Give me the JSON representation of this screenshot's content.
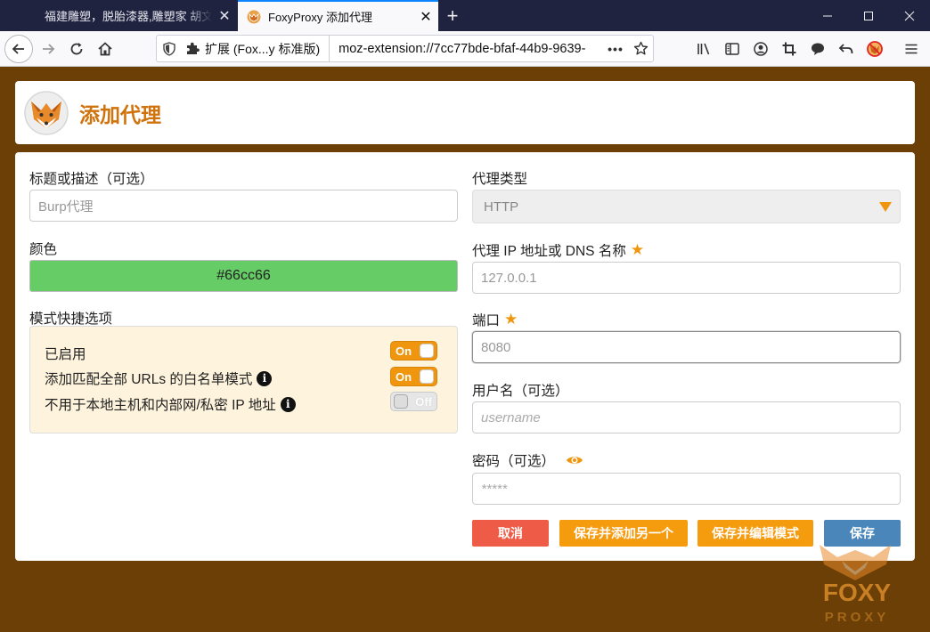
{
  "browser": {
    "tabs": [
      {
        "label": "福建雕塑，脱胎漆器,雕塑家 胡文平"
      },
      {
        "label": "FoxyProxy 添加代理"
      }
    ],
    "url_extension_label": "扩展 (Fox...y 标准版)",
    "url": "moz-extension://7cc77bde-bfaf-44b9-9639-",
    "url_more": "•••"
  },
  "page": {
    "title": "添加代理",
    "left": {
      "title_label": "标题或描述（可选）",
      "title_placeholder": "Burp代理",
      "color_label": "颜色",
      "color_value": "#66cc66",
      "pattern_label": "模式快捷选项",
      "options": [
        {
          "label": "已启用",
          "state": "On",
          "info": false
        },
        {
          "label": "添加匹配全部 URLs 的白名单模式",
          "state": "On",
          "info": true
        },
        {
          "label": "不用于本地主机和内部网/私密 IP 地址",
          "state": "Off",
          "info": true
        }
      ]
    },
    "right": {
      "type_label": "代理类型",
      "type_value": "HTTP",
      "host_label": "代理 IP 地址或 DNS 名称",
      "host_placeholder": "127.0.0.1",
      "port_label": "端口",
      "port_placeholder": "8080",
      "user_label": "用户名（可选）",
      "user_placeholder": "username",
      "pass_label": "密码（可选）",
      "pass_placeholder": "*****"
    },
    "buttons": {
      "cancel": "取消",
      "save_add": "保存并添加另一个",
      "save_edit": "保存并编辑模式",
      "save": "保存"
    },
    "watermark": {
      "line1": "FOXY",
      "line2": "PROXY"
    }
  },
  "colors": {
    "accent": "#f0960e",
    "title": "#d0730c",
    "page_bg": "#6b3f06",
    "cancel": "#ee5c47",
    "save": "#4a86ba",
    "swatch": "#66cc66"
  }
}
